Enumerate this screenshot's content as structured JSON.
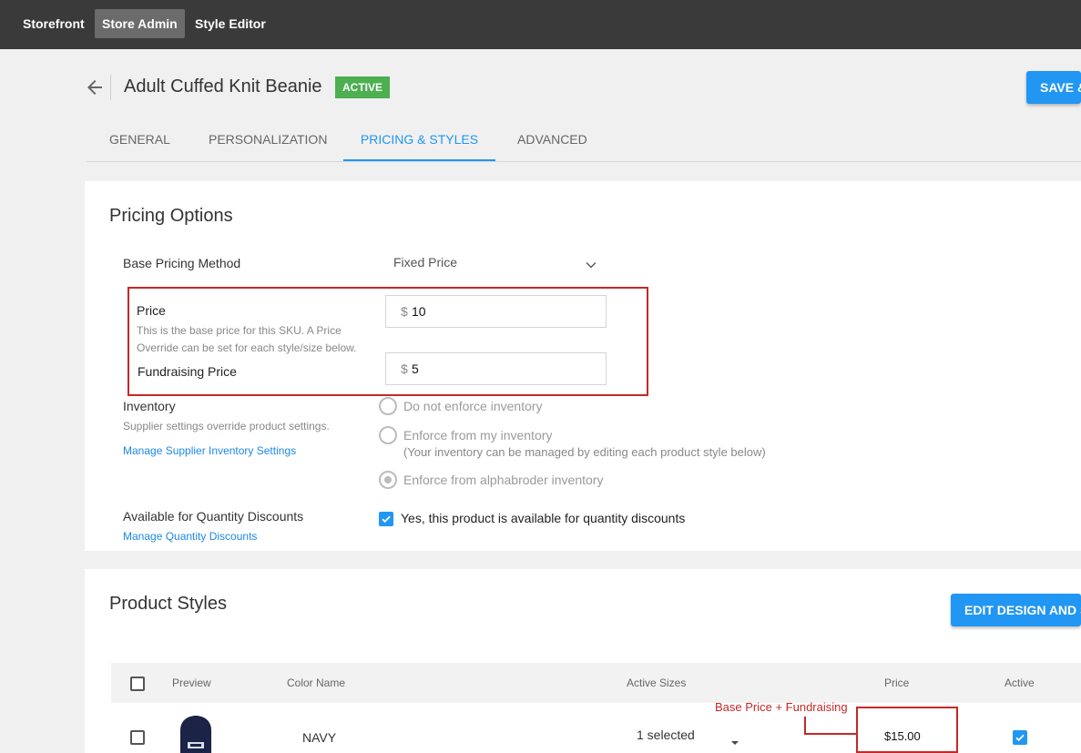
{
  "topnav": {
    "storefront": "Storefront",
    "store_admin": "Store Admin",
    "style_editor": "Style Editor"
  },
  "header": {
    "title": "Adult Cuffed Knit Beanie",
    "status": "ACTIVE",
    "save_label": "SAVE &"
  },
  "tabs": [
    "GENERAL",
    "PERSONALIZATION",
    "PRICING & STYLES",
    "ADVANCED"
  ],
  "pricing": {
    "title": "Pricing Options",
    "base_method_label": "Base Pricing Method",
    "base_method_value": "Fixed Price",
    "price_label": "Price",
    "price_hint_1": "This is the base price for this SKU. A Price",
    "price_hint_2": "Override can be set for each style/size below.",
    "currency": "$",
    "price_value": "10",
    "fundraising_label": "Fundraising Price",
    "fundraising_value": "5",
    "inventory_label": "Inventory",
    "inventory_hint": "Supplier settings override product settings.",
    "inventory_link": "Manage Supplier Inventory Settings",
    "inventory_options": [
      "Do not enforce inventory",
      "Enforce from my inventory",
      "Enforce from alphabroder inventory"
    ],
    "inventory_subnote": "(Your inventory can be managed by editing each product style below)",
    "qty_label": "Available for Quantity Discounts",
    "qty_link": "Manage Quantity Discounts",
    "qty_checkbox_label": "Yes, this product is available for quantity discounts"
  },
  "styles": {
    "title": "Product Styles",
    "edit_button": "EDIT DESIGN AND ST",
    "columns": [
      "Preview",
      "Color Name",
      "Active Sizes",
      "Price",
      "Active"
    ],
    "rows": [
      {
        "color": "NAVY",
        "sizes": "1 selected",
        "price": "$15.00"
      }
    ],
    "annotation": "Base Price + Fundraising"
  },
  "colors": {
    "accent": "#2196f3",
    "active_badge": "#4caf50",
    "annotation_red": "#c62828",
    "topbar": "#3a3a3a"
  }
}
